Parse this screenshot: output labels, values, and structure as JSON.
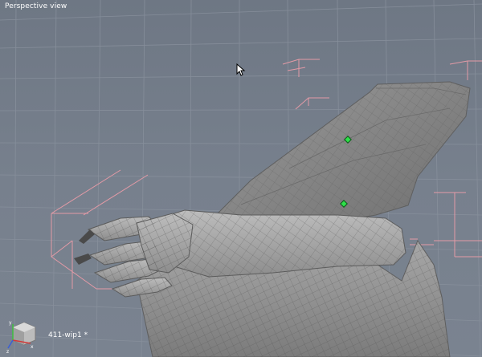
{
  "viewport": {
    "label": "Perspective view",
    "background": "#737c89",
    "grid_color": "#8a929e",
    "box_color": "#e39aa6",
    "mesh_color": "#8c8c8c"
  },
  "status": {
    "file_label": "411-wip1 *"
  },
  "axes": {
    "x_color": "#d23a3a",
    "y_color": "#3fbf3f",
    "z_color": "#3a5fd6"
  },
  "control_points_color": "#2ee04a",
  "cursor_icon": "arrow-cursor-icon"
}
